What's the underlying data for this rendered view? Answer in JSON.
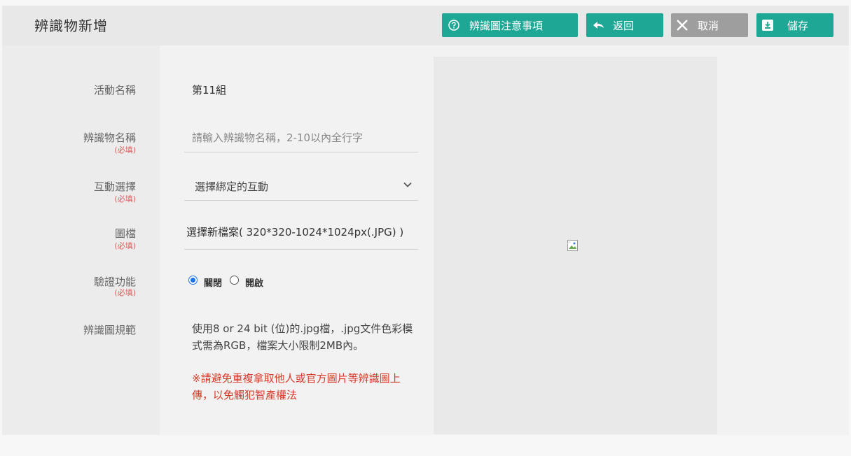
{
  "header": {
    "title": "辨識物新增",
    "buttons": {
      "guide": "辨識圖注意事項",
      "back": "返回",
      "cancel": "取消",
      "save": "儲存"
    },
    "icons": {
      "guide": "help-circle-icon",
      "back": "back-arrow-icon",
      "cancel": "close-icon",
      "save": "save-icon"
    }
  },
  "form": {
    "activity": {
      "label": "活動名稱",
      "value": "第11組"
    },
    "object_name": {
      "label": "辨識物名稱",
      "required": "(必填)",
      "placeholder": "請輸入辨識物名稱，2-10以內全行字"
    },
    "interaction": {
      "label": "互動選擇",
      "required": "(必填)",
      "selected": "選擇綁定的互動"
    },
    "image_file": {
      "label": "圖檔",
      "required": "(必填)",
      "value": "選擇新檔案( 320*320-1024*1024px(.JPG) )"
    },
    "verification": {
      "label": "驗證功能",
      "required": "(必填)",
      "options": [
        "關閉",
        "開啟"
      ],
      "selected": "關閉"
    },
    "spec": {
      "label": "辨識圖規範",
      "text": "使用8 or 24 bit (位)的.jpg檔，.jpg文件色彩模式需為RGB，檔案大小限制2MB內。",
      "warning": "※請避免重複拿取他人或官方圖片等辨識圖上傳，以免觸犯智產權法"
    }
  },
  "preview": {
    "icon": "broken-image-icon"
  },
  "colors": {
    "accent": "#1fa796",
    "cancel": "#9e9e9e",
    "required": "#e05a5a",
    "warning": "#d83a2a"
  }
}
